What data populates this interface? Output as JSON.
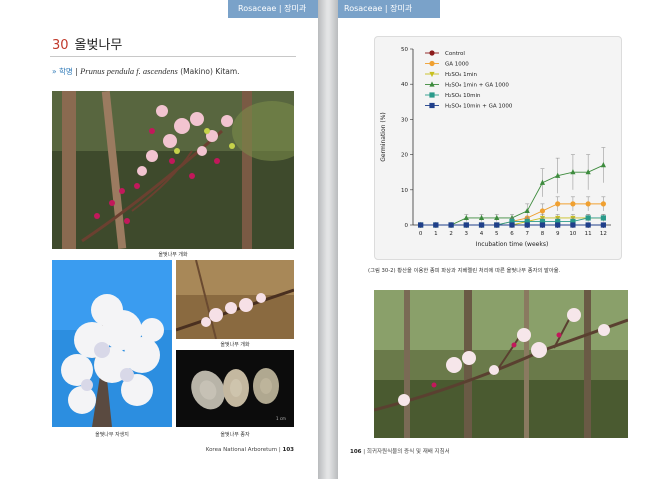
{
  "left": {
    "tab": {
      "family": "Rosaceae",
      "sep": "|",
      "korean": "장미과"
    },
    "title": {
      "number": "30",
      "name": "올벚나무"
    },
    "scientific": {
      "marker": "»",
      "label": "학명",
      "sep": "|",
      "name_italic": "Prunus pendula f. ascendens",
      "authority": "(Makino) Kitam."
    },
    "captions": [
      "올벚나무 개화",
      "올벚나무 개화",
      "올벚나무 자생지",
      "올벚나무 종자"
    ],
    "seed_scale": "1 cm",
    "footer": {
      "text": "Korea National Arboretum",
      "sep": "|",
      "page": "103"
    }
  },
  "right": {
    "tab": {
      "family": "Rosaceae",
      "sep": "|",
      "korean": "장미과"
    },
    "figure_caption": "(그림 30-2) 황산을 이용한 종피 파상과 지베렐린 처리에 따른 올벚나무 종자의 발아율.",
    "footer": {
      "page": "106",
      "sep": "|",
      "text": "희귀자원식물의 증식 및 재배 지침서"
    }
  },
  "chart_data": {
    "type": "line",
    "xlabel": "Incubation time (weeks)",
    "ylabel": "Germination (%)",
    "xlim": [
      -0.5,
      12.5
    ],
    "ylim": [
      0,
      50
    ],
    "x": [
      0,
      1,
      2,
      3,
      4,
      5,
      6,
      7,
      8,
      9,
      10,
      11,
      12
    ],
    "yticks": [
      0,
      10,
      20,
      30,
      40,
      50
    ],
    "legend_position": "top-left",
    "series": [
      {
        "name": "Control",
        "color": "#8b1a1a",
        "marker": "circle",
        "values": [
          0,
          0,
          0,
          0,
          0,
          0,
          0,
          0,
          0,
          0,
          0,
          0,
          0
        ],
        "error": [
          0,
          0,
          0,
          0,
          0,
          0,
          0,
          0,
          0,
          0,
          0,
          0,
          0
        ]
      },
      {
        "name": "GA 1000",
        "color": "#f0a030",
        "marker": "circle",
        "values": [
          0,
          0,
          0,
          0,
          0,
          0,
          1,
          2,
          4,
          6,
          6,
          6,
          6
        ],
        "error": [
          0,
          0,
          0,
          0,
          0,
          0,
          1,
          2,
          2,
          2,
          2,
          2,
          2
        ]
      },
      {
        "name": "H₂SO₄ 1min",
        "color": "#c8c020",
        "marker": "triangle-down",
        "values": [
          0,
          0,
          0,
          0,
          0,
          0,
          0,
          1,
          2,
          2,
          2,
          2,
          2
        ],
        "error": [
          0,
          0,
          0,
          0,
          0,
          0,
          0,
          1,
          1,
          1,
          1,
          1,
          1
        ]
      },
      {
        "name": "H₂SO₄ 1min + GA 1000",
        "color": "#3d8b3d",
        "marker": "triangle-up",
        "values": [
          0,
          0,
          0,
          2,
          2,
          2,
          2,
          4,
          12,
          14,
          15,
          15,
          17
        ],
        "error": [
          0,
          0,
          0,
          1,
          1,
          1,
          1,
          2,
          4,
          5,
          5,
          5,
          5
        ]
      },
      {
        "name": "H₂SO₄ 10min",
        "color": "#2a9a8a",
        "marker": "square",
        "values": [
          0,
          0,
          0,
          0,
          0,
          0,
          1,
          1,
          1,
          1,
          1,
          2,
          2
        ],
        "error": [
          0,
          0,
          0,
          0,
          0,
          0,
          1,
          1,
          1,
          1,
          1,
          1,
          1
        ]
      },
      {
        "name": "H₂SO₄ 10min + GA 1000",
        "color": "#1f3f8a",
        "marker": "square",
        "values": [
          0,
          0,
          0,
          0,
          0,
          0,
          0,
          0,
          0,
          0,
          0,
          0,
          0
        ],
        "error": [
          0,
          0,
          0,
          0,
          0,
          0,
          0,
          0,
          0,
          0,
          0,
          0,
          0
        ]
      }
    ]
  }
}
